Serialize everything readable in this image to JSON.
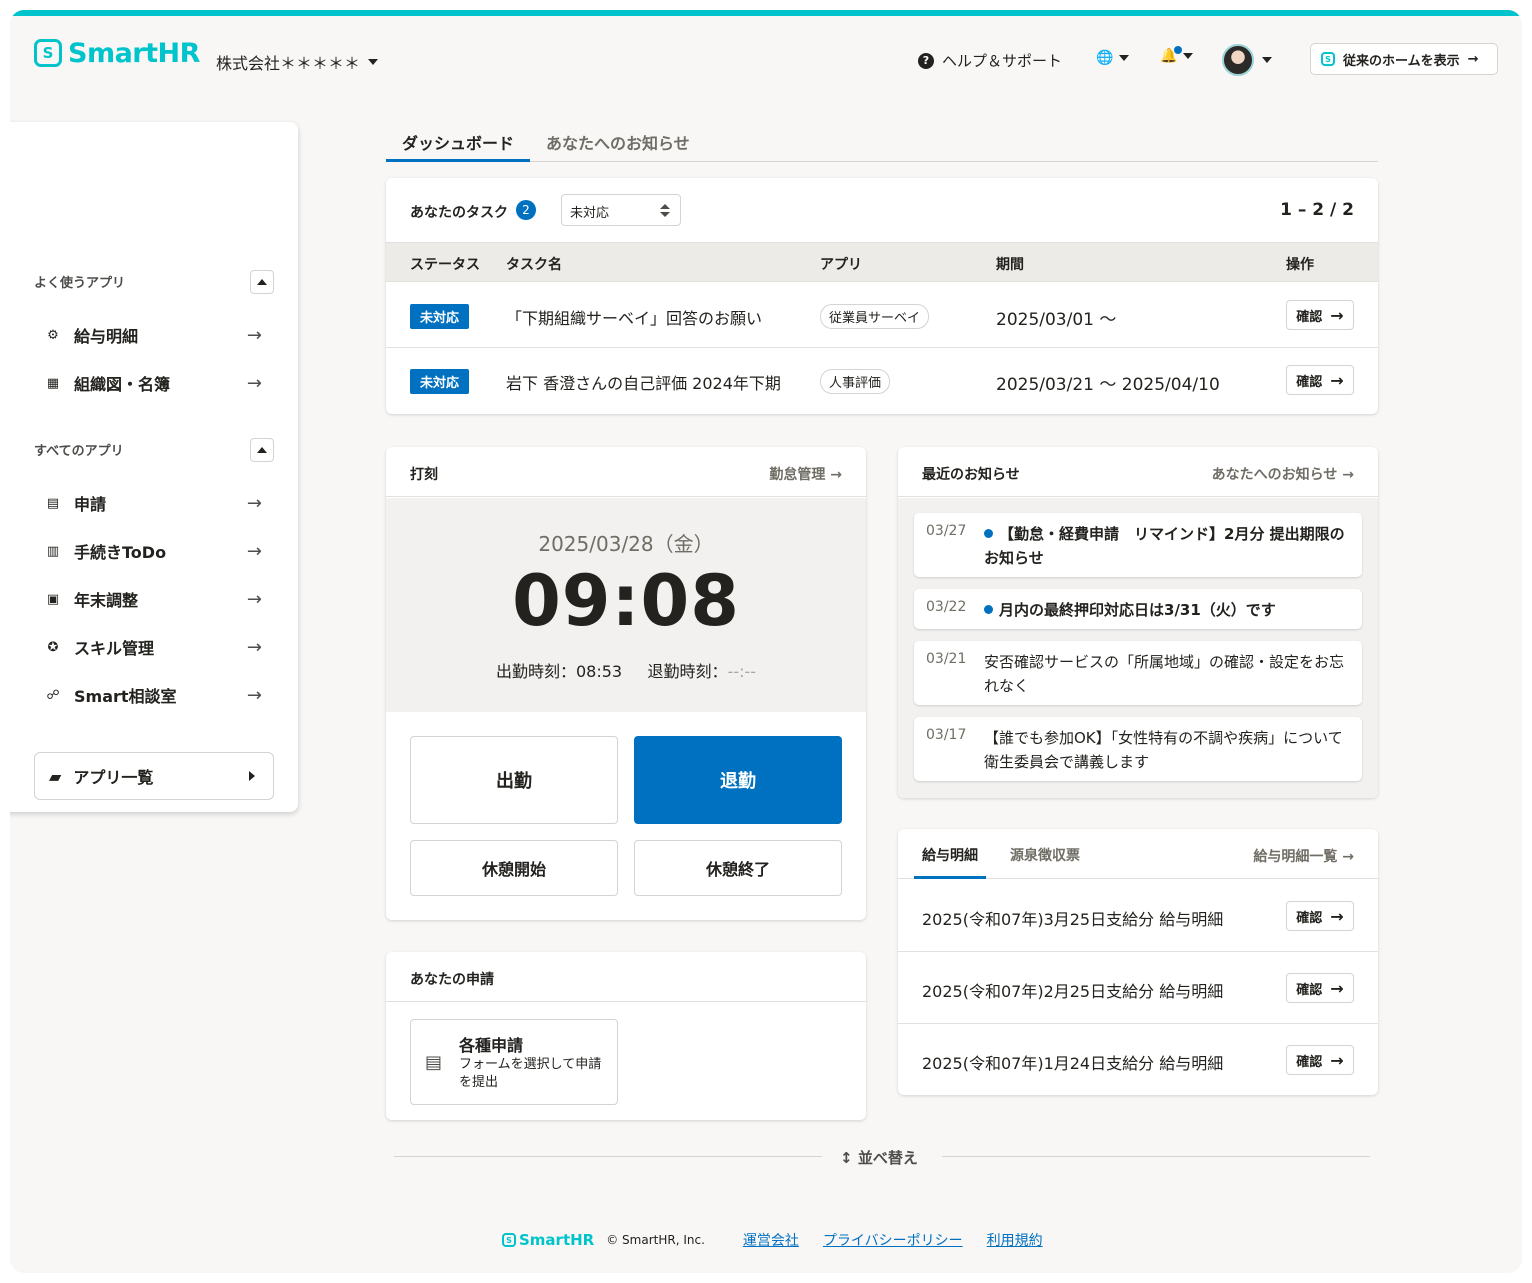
{
  "header": {
    "logo_mark": "S",
    "logo_text": "SmartHR",
    "company": "株式会社＊＊＊＊＊",
    "help_icon": "?",
    "help": "ヘルプ＆サポート",
    "globe_icon": "🌐",
    "bell_icon": "🔔",
    "old_home": "従来のホームを表示",
    "old_home_arrow": "→"
  },
  "sidebar": {
    "frequent_title": "よく使うアプリ",
    "frequent": [
      {
        "icon": "⚙",
        "label": "給与明細"
      },
      {
        "icon": "▦",
        "label": "組織図・名簿"
      }
    ],
    "all_title": "すべてのアプリ",
    "all": [
      {
        "icon": "▤",
        "label": "申請"
      },
      {
        "icon": "▥",
        "label": "手続きToDo"
      },
      {
        "icon": "▣",
        "label": "年末調整"
      },
      {
        "icon": "✪",
        "label": "スキル管理"
      },
      {
        "icon": "☍",
        "label": "Smart相談室"
      }
    ],
    "arrow": "→",
    "app_list_icon": "▰",
    "app_list": "アプリ一覧"
  },
  "tabs": {
    "dashboard": "ダッシュボード",
    "notices": "あなたへのお知らせ"
  },
  "tasks": {
    "title": "あなたのタスク",
    "count": "2",
    "filter": "未対応",
    "pager": "1 – 2 / 2",
    "headers": {
      "status": "ステータス",
      "name": "タスク名",
      "app": "アプリ",
      "period": "期間",
      "action": "操作"
    },
    "rows": [
      {
        "status": "未対応",
        "name": "「下期組織サーベイ」回答のお願い",
        "app": "従業員サーベイ",
        "period": "2025/03/01 〜",
        "action": "確認"
      },
      {
        "status": "未対応",
        "name": "岩下 香澄さんの自己評価 2024年下期",
        "app": "人事評価",
        "period": "2025/03/21 〜 2025/04/10",
        "action": "確認"
      }
    ]
  },
  "punch": {
    "title": "打刻",
    "link": "勤怠管理",
    "date": "2025/03/28（金）",
    "time": "09:08",
    "in_label": "出勤時刻：",
    "in_time": "08:53",
    "out_label": "退勤時刻：",
    "out_time": "--:--",
    "btn_in": "出勤",
    "btn_out": "退勤",
    "btn_break_start": "休憩開始",
    "btn_break_end": "休憩終了"
  },
  "requests": {
    "title": "あなたの申請",
    "btn_icon": "▤",
    "btn_title": "各種申請",
    "btn_desc": "フォームを選択して申請を提出"
  },
  "news": {
    "title": "最近のお知らせ",
    "link": "あなたへのお知らせ",
    "items": [
      {
        "date": "03/27",
        "text": "【勤怠・経費申請　リマインド】2月分 提出期限のお知らせ",
        "unread": true
      },
      {
        "date": "03/22",
        "text": "月内の最終押印対応日は3/31（火）です",
        "unread": true
      },
      {
        "date": "03/21",
        "text": "安否確認サービスの「所属地域」の確認・設定をお忘れなく",
        "unread": false
      },
      {
        "date": "03/17",
        "text": "【誰でも参加OK】「女性特有の不調や疾病」について衛生委員会で講義します",
        "unread": false
      }
    ]
  },
  "payslip": {
    "tab_pay": "給与明細",
    "tab_tax": "源泉徴収票",
    "link": "給与明細一覧",
    "rows": [
      {
        "label": "2025(令和07年)3月25日支給分 給与明細",
        "action": "確認"
      },
      {
        "label": "2025(令和07年)2月25日支給分 給与明細",
        "action": "確認"
      },
      {
        "label": "2025(令和07年)1月24日支給分 給与明細",
        "action": "確認"
      }
    ]
  },
  "sort": {
    "icon": "↕",
    "label": "並べ替え"
  },
  "footer": {
    "logo": "SmartHR",
    "copyright": "© SmartHR, Inc.",
    "links": [
      "運営会社",
      "プライバシーポリシー",
      "利用規約"
    ]
  },
  "colors": {
    "brand": "#00c4cc",
    "primary": "#0071c1"
  }
}
